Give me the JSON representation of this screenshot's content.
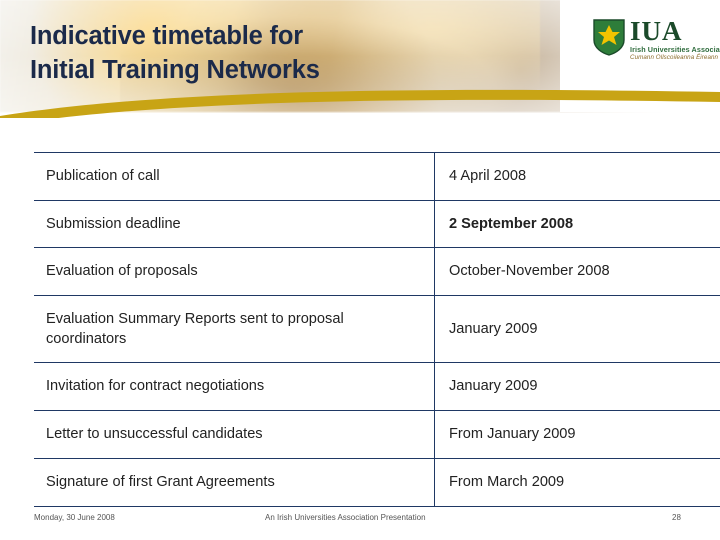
{
  "slide": {
    "title": "Indicative timetable for\nInitial Training Networks",
    "logo": {
      "acronym": "IUA",
      "name_line": "Irish Universities Association",
      "irish_line": "Cumann Ollscoileanna Éireann",
      "shield_icon": "shield-icon"
    },
    "table": {
      "rows": [
        {
          "activity": "Publication of call",
          "date": "4 April 2008",
          "highlight": false
        },
        {
          "activity": "Submission deadline",
          "date": "2 September 2008",
          "highlight": true
        },
        {
          "activity": "Evaluation of proposals",
          "date": "October-November 2008",
          "highlight": false
        },
        {
          "activity": "Evaluation Summary Reports sent to proposal coordinators",
          "date": "January 2009",
          "highlight": false
        },
        {
          "activity": "Invitation for contract negotiations",
          "date": "January 2009",
          "highlight": false
        },
        {
          "activity": "Letter to unsuccessful candidates",
          "date": "From January 2009",
          "highlight": false
        },
        {
          "activity": "Signature of first Grant Agreements",
          "date": "From March 2009",
          "highlight": false
        }
      ]
    },
    "footer": {
      "date": "Monday, 30 June 2008",
      "center": "An Irish Universities Association Presentation",
      "page": "28"
    },
    "colors": {
      "title": "#1b2a4a",
      "swoosh": "#c8a415",
      "highlight": "#b00000",
      "table_border": "#1f3864"
    }
  }
}
